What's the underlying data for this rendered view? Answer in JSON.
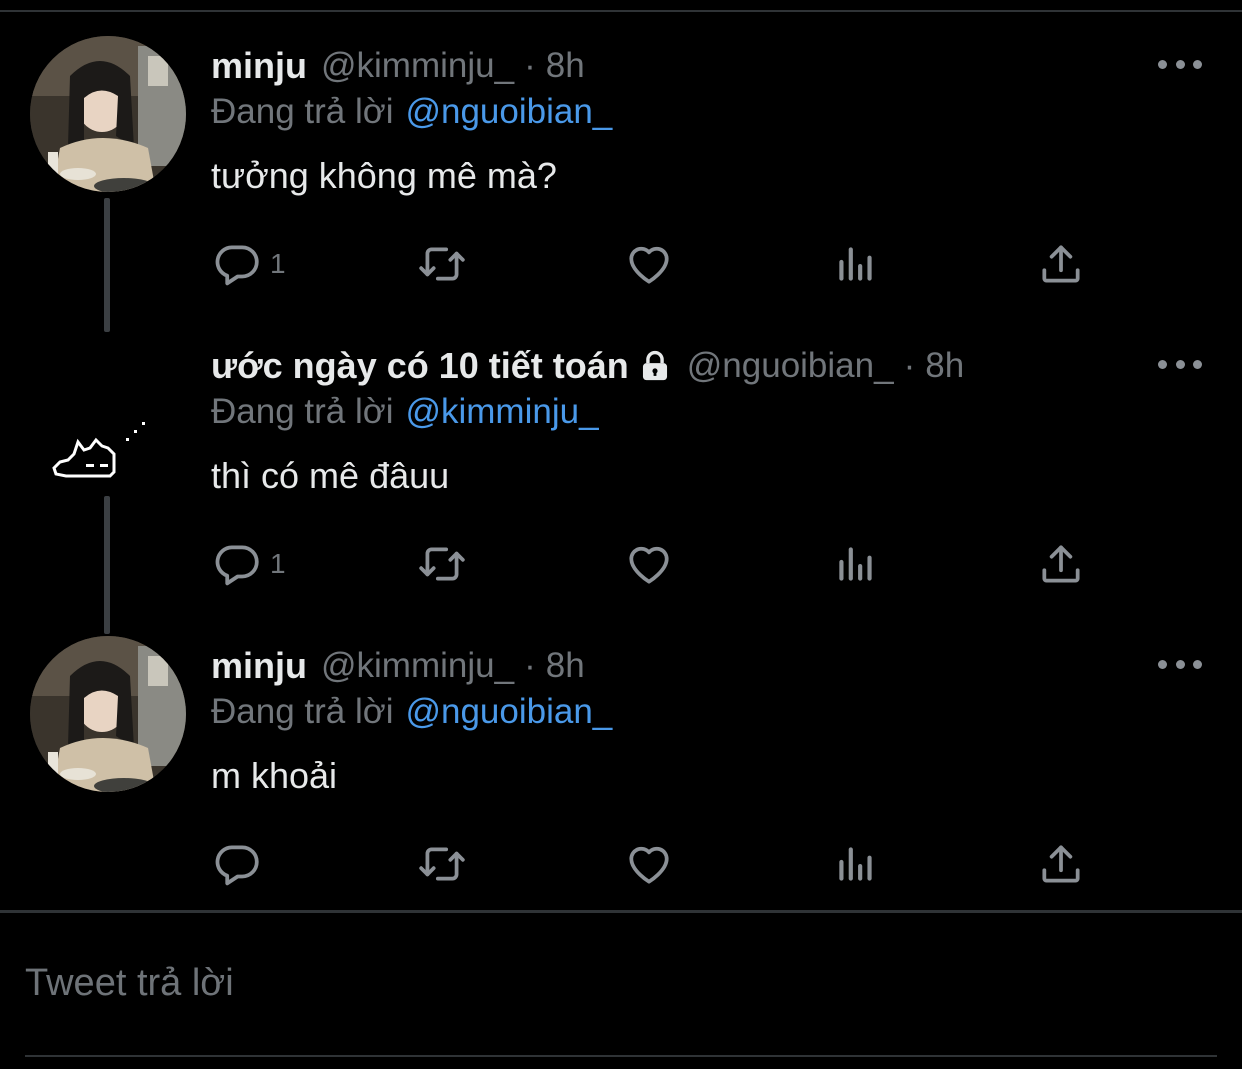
{
  "tweets": [
    {
      "name": "minju",
      "handle": "@kimminju_",
      "separator": "·",
      "time": "8h",
      "replying_label": "Đang trả lời",
      "replying_to": "@nguoibian_",
      "text": "tưởng không mê mà?",
      "reply_count": "1",
      "locked": false,
      "avatar": "girl-photo"
    },
    {
      "name": "ước ngày có 10 tiết toán",
      "handle": "@nguoibian_",
      "separator": "·",
      "time": "8h",
      "replying_label": "Đang trả lời",
      "replying_to": "@kimminju_",
      "text": "thì có mê đâuu",
      "reply_count": "1",
      "locked": true,
      "avatar": "sleeping-cat-pixel"
    },
    {
      "name": "minju",
      "handle": "@kimminju_",
      "separator": "·",
      "time": "8h",
      "replying_label": "Đang trả lời",
      "replying_to": "@nguoibian_",
      "text": "m khoải",
      "reply_count": "",
      "locked": false,
      "avatar": "girl-photo"
    }
  ],
  "composer": {
    "placeholder": "Tweet trả lời"
  },
  "colors": {
    "background": "#000000",
    "text": "#e7e9ea",
    "muted": "#71767b",
    "mention": "#4a99e9",
    "divider": "#2f3336"
  },
  "icons": [
    "reply-icon",
    "retweet-icon",
    "like-icon",
    "analytics-icon",
    "share-icon",
    "more-icon",
    "lock-icon"
  ]
}
